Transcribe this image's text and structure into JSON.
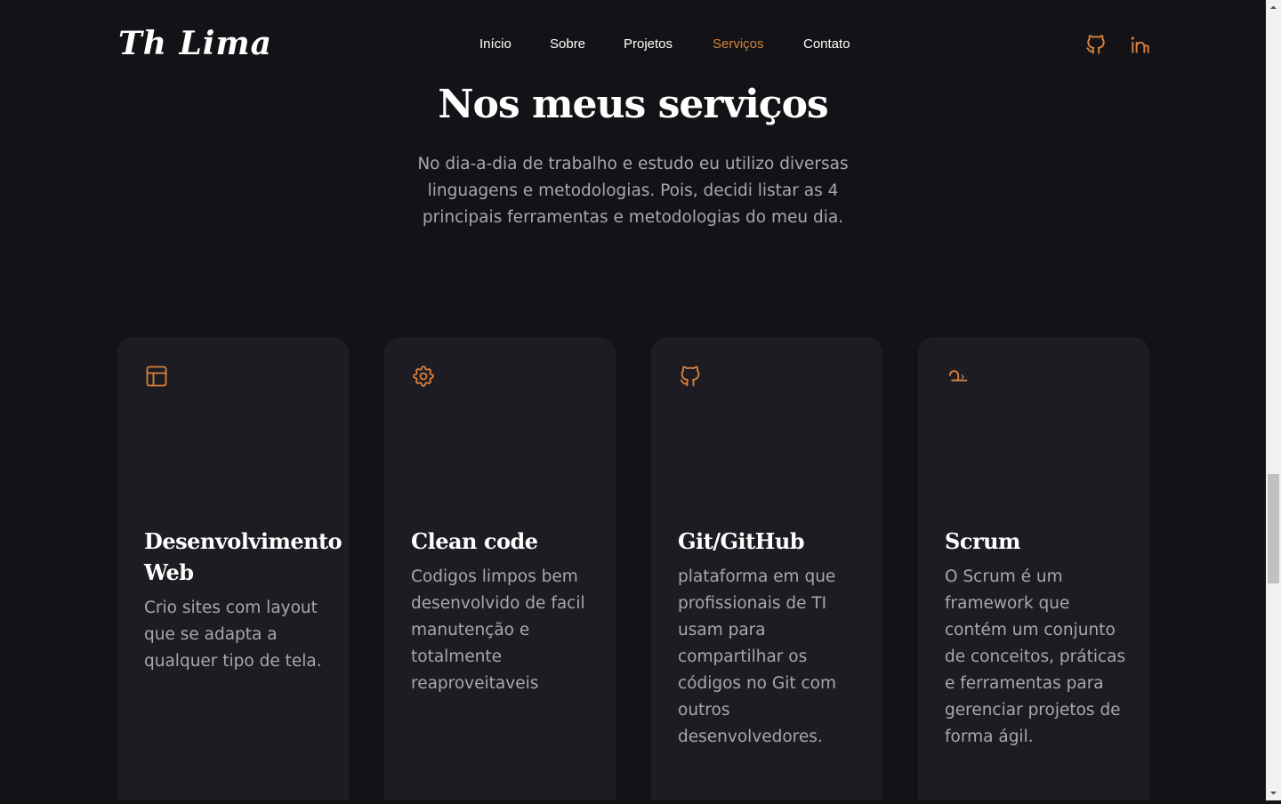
{
  "header": {
    "logo": "Th Lima",
    "nav": [
      {
        "label": "Início",
        "active": false
      },
      {
        "label": "Sobre",
        "active": false
      },
      {
        "label": "Projetos",
        "active": false
      },
      {
        "label": "Serviços",
        "active": true
      },
      {
        "label": "Contato",
        "active": false
      }
    ],
    "social_icons": [
      "github-icon",
      "linkedin-icon"
    ]
  },
  "services": {
    "title": "Nos meus serviços",
    "subtitle": "No dia-a-dia de trabalho e estudo eu utilizo diversas linguagens e metodologias. Pois, decidi listar as 4 principais ferramentas e metodologias do meu dia.",
    "cards": [
      {
        "icon": "layout-icon",
        "title": "Desenvolvimento Web",
        "text": "Crio sites com layout que se adapta a qualquer tipo de tela."
      },
      {
        "icon": "gear-icon",
        "title": "Clean code",
        "text": "Codigos limpos bem desenvolvido de facil manutenção e totalmente reaproveitaveis"
      },
      {
        "icon": "github-icon",
        "title": "Git/GitHub",
        "text": "plataforma em que profissionais de TI usam para compartilhar os códigos no Git com outros desenvolvedores."
      },
      {
        "icon": "scrum-icon",
        "title": "Scrum",
        "text": "O Scrum é um framework que contém um conjunto de conceitos, práticas e ferramentas para gerenciar projetos de forma ágil."
      }
    ]
  },
  "colors": {
    "background": "#131317",
    "card": "#1c1c22",
    "accent": "#d7803e",
    "text_muted": "#a7a7b0"
  }
}
